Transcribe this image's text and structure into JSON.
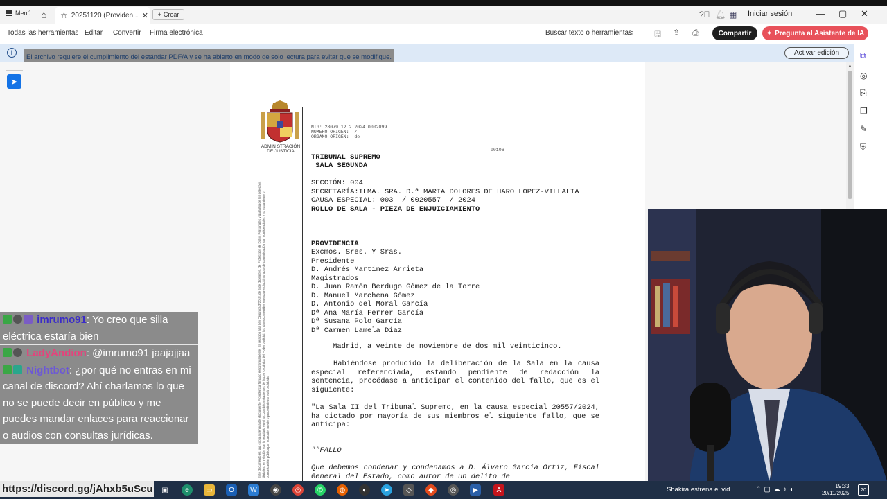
{
  "titlebar": {
    "menu_label": "Menú",
    "tab_title": "20251120 (Providen...",
    "crear_label": "Crear",
    "signin_label": "Iniciar sesión"
  },
  "toolbar": {
    "items": [
      "Todas las herramientas",
      "Editar",
      "Convertir",
      "Firma electrónica"
    ],
    "search_label": "Buscar texto o herramientas",
    "share_label": "Compartir",
    "ai_label": "Pregunta al Asistente de IA"
  },
  "banner": {
    "message": "El archivo requiere el cumplimiento del estándar PDF/A y se ha abierto en modo de solo lectura para evitar que se modifique.",
    "action_label": "Activar edición"
  },
  "document": {
    "emblem_caption": "ADMINISTRACIÓN\nDE JUSTICIA",
    "header_small": "NIG: 28079 12 2 2024 0002099\nNUMERO ORIGEN:  /\nORGANO ORIGEN:  de",
    "page_code": "00106",
    "court": "TRIBUNAL SUPREMO\n SALA SEGUNDA",
    "seccion": "SECCIÓN: 004\nSECRETARÍA:ILMA. SRA. D.ª MARIA DOLORES DE HARO LOPEZ-VILLALTA\nCAUSA ESPECIAL: 003  / 0020557  / 2024",
    "rollo": "ROLLO DE SALA - PIEZA DE ENJUICIAMIENTO",
    "providencia": "PROVIDENCIA",
    "magistrados": "Excmos. Sres. Y Sras.\nPresidente\nD. Andrés Martinez Arrieta\nMagistrados\nD. Juan Ramón Berdugo Gómez de la Torre\nD. Manuel Marchena Gómez\nD. Antonio del Moral García\nDª Ana María Ferrer García\nDª Susana Polo García\nDª Carmen Lamela Díaz",
    "fecha": "     Madrid, a veinte de noviembre de dos mil veinticinco.",
    "parrafo1": "Habiéndose producido la deliberación de la Sala en la causa especial referenciada, estando pendiente de redacción la sentencia, procédase a anticipar el contenido del fallo, que es el siguiente:",
    "parrafo2": "\"La Sala II del Tribunal Supremo, en la causa especial 20557/2024, ha dictado por mayoría de sus miembros el siguiente fallo, que se anticipa:",
    "fallo_title": "\"\"FALLO",
    "fallo_text": "Que debemos condenar y condenamos a D. Álvaro García Ortiz, Fiscal General del Estado, como autor de un delito de",
    "side_text": "Este documento es una copia auténtica del documento Providencia firmado electrónicamente. En relación a la Ley Orgánica 3/2018, de 5 de diciembre, de Protección de Datos Personales y garantía de los derechos digitales, en relación con lo regulado en el art. 236 bis y siguientes de la Ley Orgánica del Poder Judicial, los datos contenidos en esta resolución o acto de comunicación son confidenciales y su tratamiento o comunicación pública por cualquier medio o procedimiento está prohibida."
  },
  "chat": [
    {
      "user": "imrumo91",
      "user_color": "#3b2cc8",
      "text": ": Yo creo que silla eléctrica estaría bien"
    },
    {
      "user": "LadyAndion",
      "user_color": "#e4437c",
      "text": ": @imrumo91 jaajajjaa"
    },
    {
      "user": "Nightbot",
      "user_color": "#6c58d6",
      "text": ": ¿por qué no entras en mi canal de discord? Ahí charlamos lo que no se puede decir en público y me puedes mandar enlaces para reaccionar o audios con consultas jurídicas."
    }
  ],
  "overlay_link": "https://discord.gg/jAhxb5uScu",
  "taskbar": {
    "news": "Shakira estrena el vid...",
    "time": "19:33",
    "date": "20/11/2025",
    "notif_count": "20"
  },
  "colors": {
    "share_bg": "#1e1e1e",
    "ai_bg": "#e8515a",
    "banner_bg": "#dde9f7",
    "taskbar_bg": "#1f2f46",
    "select_blue": "#1473e6"
  }
}
